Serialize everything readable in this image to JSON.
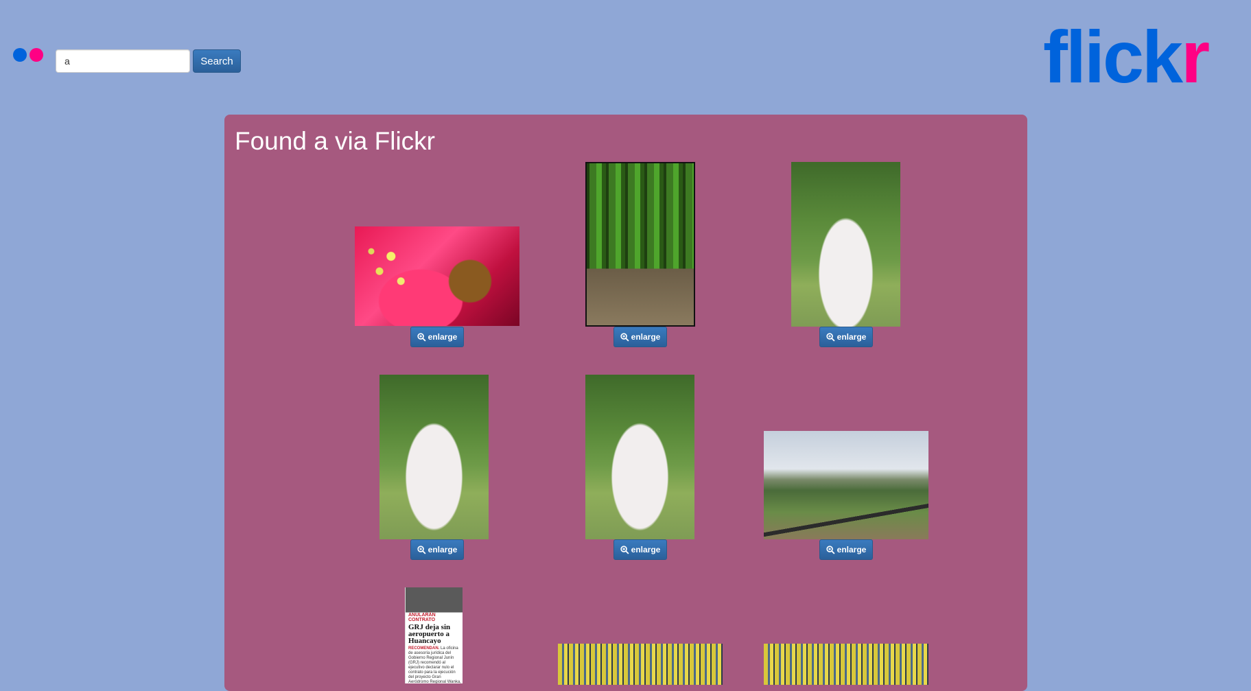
{
  "header": {
    "search_value": "a",
    "search_button_label": "Search",
    "logo_text_blue": "flick",
    "logo_text_pink": "r",
    "colors": {
      "brand_blue": "#0063dc",
      "brand_pink": "#ff0084",
      "background": "#8fa7d6",
      "panel": "#a6597f"
    }
  },
  "results": {
    "title": "Found a via Flickr",
    "enlarge_label": "enlarge",
    "photos": [
      {
        "subject": "pink flower with ornate cross"
      },
      {
        "subject": "forest path with wooden steps"
      },
      {
        "subject": "white cygnet sitting in grass"
      },
      {
        "subject": "white cygnet resting in grass"
      },
      {
        "subject": "white cygnet resting in grass"
      },
      {
        "subject": "steam train in countryside"
      },
      {
        "subject": "newspaper clipping",
        "kicker": "ANULARÁN CONTRATO",
        "headline": "GRJ deja sin aeropuerto a Huancayo",
        "lead": "RECOMENDAN.",
        "body": "La oficina de asesoría jurídica del Gobierno Regional Junín (GRJ) recomendó al ejecutivo declarar nulo el contrato para la ejecución del proyecto Gran Aeródromo Regional Wanka, cuya construcción estaba prevista en los terrenos de Tezaya (Huancayo) y"
      },
      {
        "subject": "stadium stands"
      },
      {
        "subject": "stadium stands with people"
      }
    ]
  }
}
